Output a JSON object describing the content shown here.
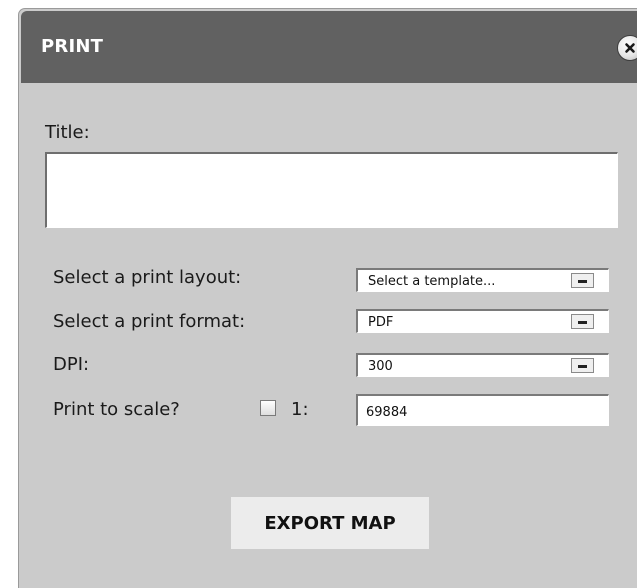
{
  "dialog": {
    "title": "PRINT",
    "close_icon": "close-icon"
  },
  "title_field": {
    "label": "Title:",
    "value": "",
    "placeholder": ""
  },
  "layout": {
    "label": "Select a print layout:",
    "selected": "Select a template..."
  },
  "format": {
    "label": "Select a print format:",
    "selected": "PDF"
  },
  "dpi": {
    "label": "DPI:",
    "selected": "300"
  },
  "scale": {
    "label": "Print to scale?",
    "checked": false,
    "ratio_prefix": "1:",
    "value": "69884"
  },
  "actions": {
    "export_label": "EXPORT MAP"
  }
}
